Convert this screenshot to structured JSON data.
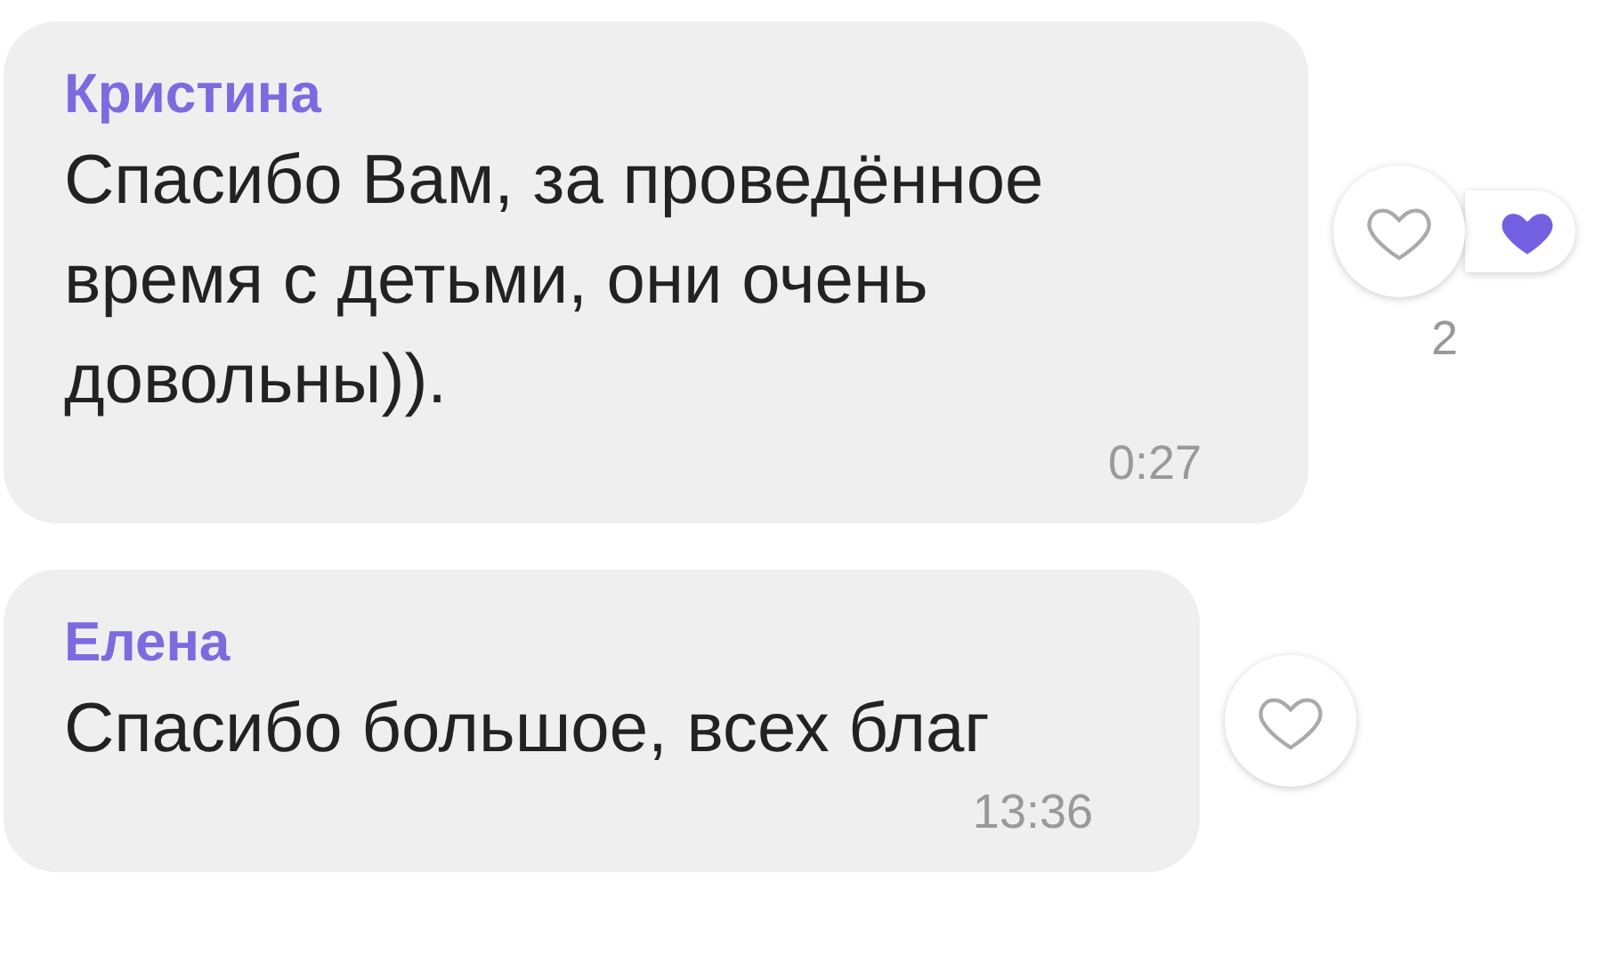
{
  "messages": [
    {
      "author": "Кристина",
      "text": "Спасибо Вам, за проведённое время с детьми, они очень довольны)).",
      "time": "0:27",
      "liked": false,
      "reaction_count": "2"
    },
    {
      "author": "Елена",
      "text": "Спасибо большое, всех благ",
      "time": "13:36",
      "liked": false
    }
  ]
}
